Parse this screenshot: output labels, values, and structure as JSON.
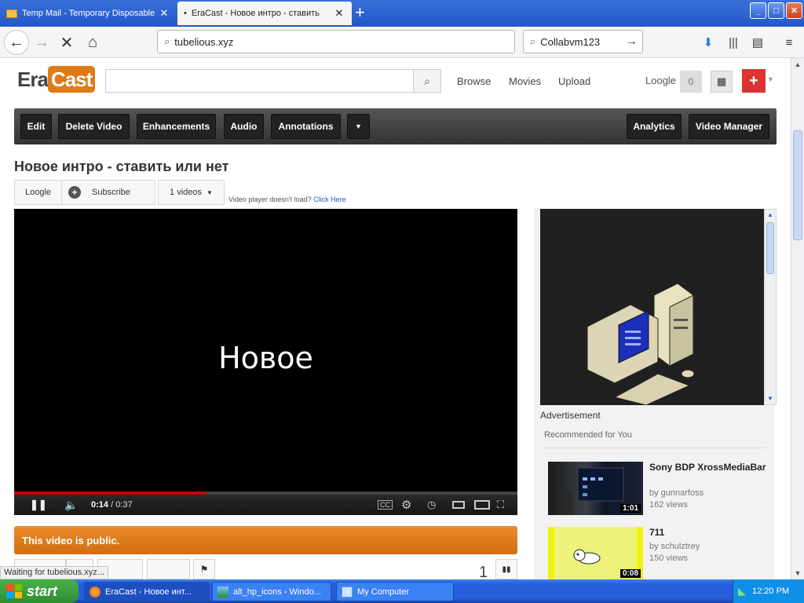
{
  "browser": {
    "tabs": [
      {
        "title": "Temp Mail - Temporary Disposable",
        "active": false
      },
      {
        "title": "EraCast - Новое интро - ставить",
        "active": true
      }
    ],
    "new_tab_label": "+",
    "window_controls": {
      "minimize": "_",
      "maximize": "□",
      "close": "✕"
    },
    "url": "tubelious.xyz",
    "search_query": "Collabvm123",
    "status_text": "Waiting for tubelious.xyz..."
  },
  "site": {
    "logo": {
      "part1": "Era",
      "part2": "Cast"
    },
    "search_placeholder": "",
    "nav": {
      "browse": "Browse",
      "movies": "Movies",
      "upload": "Upload"
    },
    "user": {
      "name": "Loogle",
      "count": "0"
    }
  },
  "toolbar": {
    "edit": "Edit",
    "delete": "Delete Video",
    "enhancements": "Enhancements",
    "audio": "Audio",
    "annotations": "Annotations",
    "more": "▼",
    "analytics": "Analytics",
    "manager": "Video Manager"
  },
  "video": {
    "title": "Новое интро - ставить или нет",
    "channel": "Loogle",
    "subscribe": "Subscribe",
    "videos_count": "1 videos",
    "player_note": "Video player doesn't load?",
    "player_link": "Click Here",
    "frame_text": "Новое",
    "current_time": "0:14",
    "time_separator": " / ",
    "duration": "0:37",
    "progress": 0.38,
    "public_notice": "This video is public.",
    "like_count": "1"
  },
  "sidebar": {
    "ad_label": "Advertisement",
    "recommended_header": "Recommended for You",
    "items": [
      {
        "title": "Sony BDP XrossMediaBar",
        "by": "by gunnarfoss",
        "views": "162 views",
        "duration": "1:01"
      },
      {
        "title": "711",
        "by": "by schulztrey",
        "views": "150 views",
        "duration": "0:08"
      }
    ]
  },
  "taskbar": {
    "start": "start",
    "items": [
      {
        "label": "EraCast - Новое инт..."
      },
      {
        "label": "alt_hp_icons - Windo..."
      },
      {
        "label": "My Computer"
      }
    ],
    "clock": "12:20 PM"
  },
  "colors": {
    "accent_orange": "#e07a15",
    "toolbar_dark": "#333333",
    "link_blue": "#1a5bbf",
    "progress_red": "#cc0000",
    "taskbar_blue": "#245edb"
  }
}
